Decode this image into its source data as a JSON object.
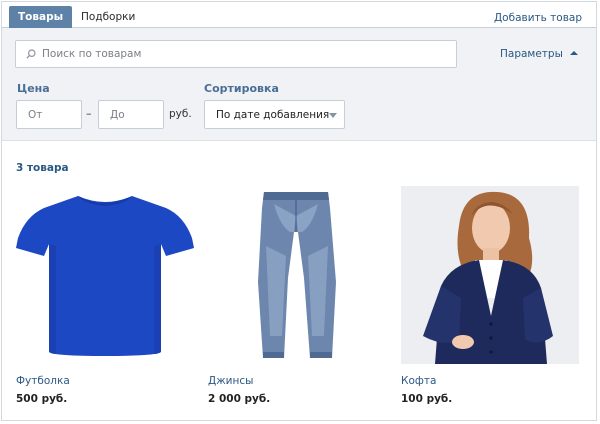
{
  "tabs": [
    {
      "label": "Товары",
      "active": true
    },
    {
      "label": "Подборки",
      "active": false
    }
  ],
  "add_product_label": "Добавить товар",
  "search": {
    "placeholder": "Поиск по товарам",
    "value": ""
  },
  "params_label": "Параметры",
  "filters": {
    "price_label": "Цена",
    "price_from_placeholder": "От",
    "price_to_placeholder": "До",
    "dash": "–",
    "currency": "руб.",
    "sort_label": "Сортировка",
    "sort_value": "По дате добавления"
  },
  "results": {
    "count_label": "3 товара",
    "items": [
      {
        "name": "Футболка",
        "price": "500 руб.",
        "image": "blue-t-shirt"
      },
      {
        "name": "Джинсы",
        "price": "2 000 руб.",
        "image": "blue-jeans"
      },
      {
        "name": "Кофта",
        "price": "100 руб.",
        "image": "navy-cardigan"
      }
    ]
  },
  "colors": {
    "accent": "#2a5885",
    "tab_active_bg": "#5e81a8",
    "filter_bg": "#f0f2f5",
    "tshirt": "#1d48c4",
    "denim": "#6c86ad",
    "cardigan": "#1e2a5c"
  }
}
